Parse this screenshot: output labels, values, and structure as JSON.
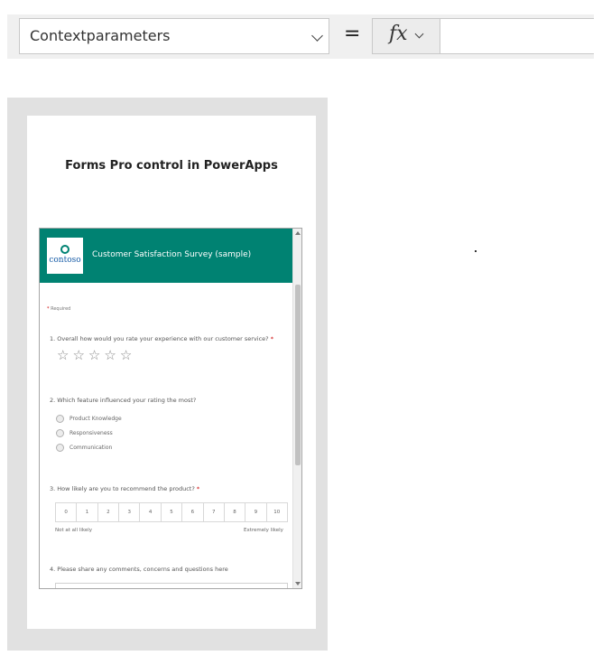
{
  "formula_bar": {
    "property": "Contextparameters",
    "equals": "=",
    "fx_label": "fx",
    "formula": ""
  },
  "screen": {
    "title": "Forms Pro control in PowerApps"
  },
  "form": {
    "logo_text": "contoso",
    "title": "Customer Satisfaction Survey (sample)",
    "required_note": "Required",
    "q1": "1. Overall how would you rate your experience with our customer service?",
    "star_glyph": "☆",
    "star_count": 5,
    "q2": "2. Which feature influenced your rating the most?",
    "q2_options": [
      "Product Knowledge",
      "Responsiveness",
      "Communication"
    ],
    "q3": "3. How likely are you to recommend the product?",
    "nps_values": [
      "0",
      "1",
      "2",
      "3",
      "4",
      "5",
      "6",
      "7",
      "8",
      "9",
      "10"
    ],
    "nps_low_label": "Not at all likely",
    "nps_high_label": "Extremely likely",
    "q4": "4. Please share any comments, concerns and questions here"
  },
  "colors": {
    "form_header": "#008272",
    "canvas_frame": "#e1e1e1",
    "required_asterisk": "#cc0000"
  }
}
